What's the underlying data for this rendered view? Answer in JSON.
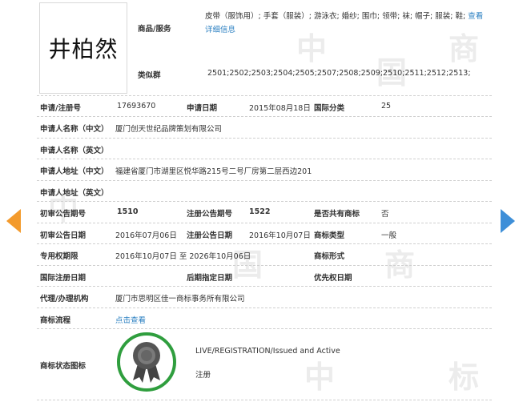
{
  "mark_name": "井柏然",
  "goods_label": "商品/服务",
  "goods_text": "皮带（服饰用）; 手套（服装）; 游泳衣; 婚纱; 围巾; 领带; 袜; 帽子; 服装; 鞋;",
  "goods_more_link": "查看详细信息",
  "similar_label": "类似群",
  "similar_value": "2501;2502;2503;2504;2505;2507;2508;2509;2510;2511;2512;2513;",
  "fields": {
    "reg_no_label": "申请/注册号",
    "reg_no": "17693670",
    "app_date_label": "申请日期",
    "app_date": "2015年08月18日",
    "intl_class_label": "国际分类",
    "intl_class": "25",
    "applicant_cn_label": "申请人名称（中文）",
    "applicant_cn": "厦门创天世纪品牌策划有限公司",
    "applicant_en_label": "申请人名称（英文）",
    "address_cn_label": "申请人地址（中文）",
    "address_cn": "福建省厦门市湖里区悦华路215号二号厂房第二层西边201",
    "address_en_label": "申请人地址（英文）",
    "prelim_no_label": "初审公告期号",
    "prelim_no": "1510",
    "reg_pub_no_label": "注册公告期号",
    "reg_pub_no": "1522",
    "shared_label": "是否共有商标",
    "shared": "否",
    "prelim_date_label": "初审公告日期",
    "prelim_date": "2016年07月06日",
    "reg_pub_date_label": "注册公告日期",
    "reg_pub_date": "2016年10月07日",
    "mark_type_label": "商标类型",
    "mark_type": "一般",
    "exclusive_label": "专用权期限",
    "exclusive": "2016年10月07日 至 2026年10月06日",
    "mark_form_label": "商标形式",
    "intl_reg_date_label": "国际注册日期",
    "later_date_label": "后期指定日期",
    "priority_date_label": "优先权日期",
    "agent_label": "代理/办理机构",
    "agent": "厦门市思明区佳一商标事务所有限公司",
    "flow_label": "商标流程",
    "flow_link": "点击查看",
    "status_icon_label": "商标状态图标",
    "status_en": "LIVE/REGISTRATION/Issued and Active",
    "status_cn": "注册"
  },
  "colors": {
    "link": "#2a7fc1",
    "badge_ring": "#2f9e3e",
    "arrow_left": "#f39a2c",
    "arrow_right": "#3e8fd8"
  },
  "icons": [
    "award-ribbon-icon",
    "arrow-left-icon",
    "arrow-right-icon"
  ]
}
